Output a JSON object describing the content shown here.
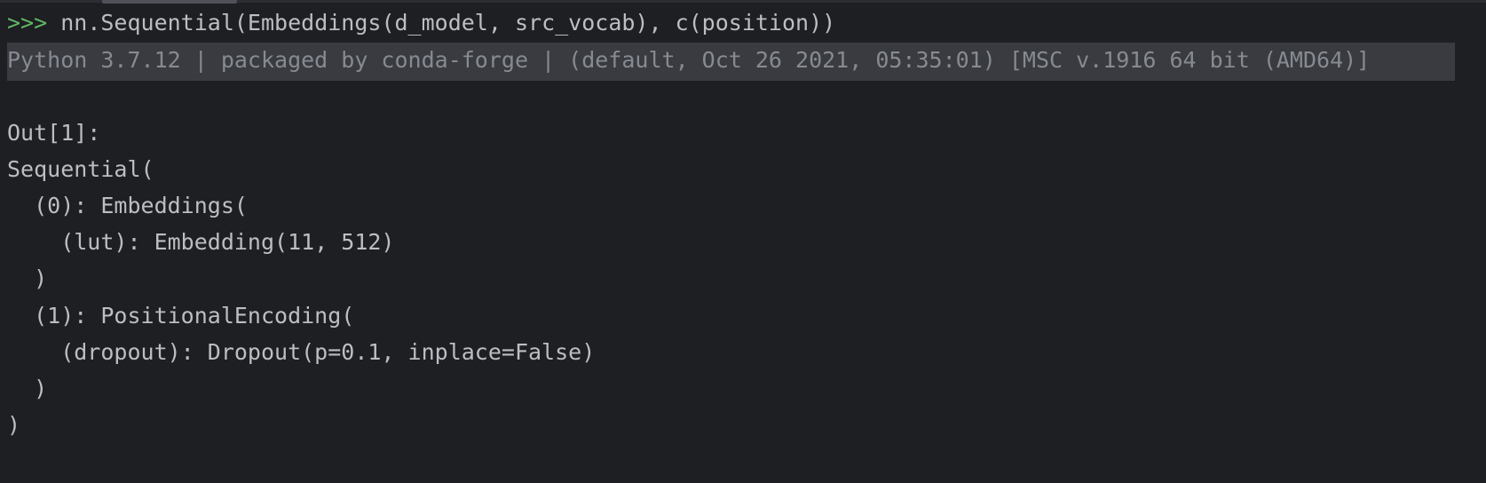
{
  "console": {
    "input": {
      "prompt": ">>>",
      "command": "nn.Sequential(Embeddings(d_model, src_vocab), c(position))"
    },
    "banner": "Python 3.7.12 | packaged by conda-forge | (default, Oct 26 2021, 05:35:01) [MSC v.1916 64 bit (AMD64)]",
    "output": {
      "label": "Out[1]:",
      "lines": [
        "Sequential(",
        "  (0): Embeddings(",
        "    (lut): Embedding(11, 512)",
        "  )",
        "  (1): PositionalEncoding(",
        "    (dropout): Dropout(p=0.1, inplace=False)",
        "  )",
        ")"
      ]
    }
  },
  "colors": {
    "background": "#1e1f22",
    "prompt": "#5fb865",
    "text": "#bcbec4",
    "banner_text": "#868a91",
    "banner_bg": "#393b40"
  }
}
